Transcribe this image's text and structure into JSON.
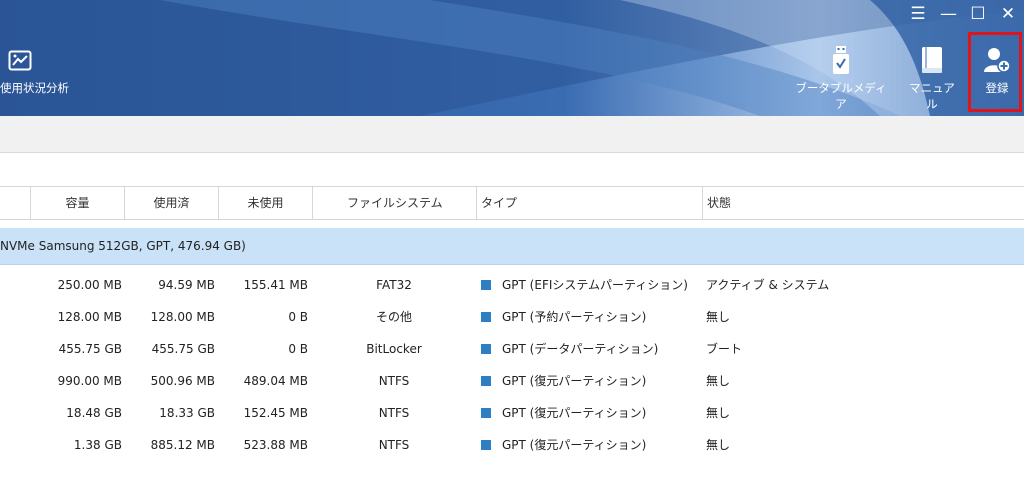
{
  "window_controls": {
    "menu": "☰",
    "minimize": "—",
    "maximize": "☐",
    "close": "✕"
  },
  "toolbar": {
    "usage_label": "使用状況分析",
    "media_label": "ブータブルメディア",
    "manual_label": "マニュアル",
    "register_label": "登録"
  },
  "colors": {
    "header": "#2f5d9f",
    "highlight": "#e0141b",
    "selected_row": "#c9e2f7",
    "type_marker": "#2e7fc1"
  },
  "table": {
    "headers": {
      "capacity": "容量",
      "used": "使用済",
      "unused": "未使用",
      "filesystem": "ファイルシステム",
      "type": "タイプ",
      "status": "状態"
    },
    "disk_label": "NVMe Samsung 512GB, GPT, 476.94 GB)",
    "rows": [
      {
        "capacity": "250.00 MB",
        "used": "94.59 MB",
        "unused": "155.41 MB",
        "fs": "FAT32",
        "type": "GPT (EFIシステムパーティション)",
        "status": "アクティブ & システム"
      },
      {
        "capacity": "128.00 MB",
        "used": "128.00 MB",
        "unused": "0 B",
        "fs": "その他",
        "type": "GPT (予約パーティション)",
        "status": "無し"
      },
      {
        "capacity": "455.75 GB",
        "used": "455.75 GB",
        "unused": "0 B",
        "fs": "BitLocker",
        "type": "GPT (データパーティション)",
        "status": "ブート"
      },
      {
        "capacity": "990.00 MB",
        "used": "500.96 MB",
        "unused": "489.04 MB",
        "fs": "NTFS",
        "type": "GPT (復元パーティション)",
        "status": "無し"
      },
      {
        "capacity": "18.48 GB",
        "used": "18.33 GB",
        "unused": "152.45 MB",
        "fs": "NTFS",
        "type": "GPT (復元パーティション)",
        "status": "無し"
      },
      {
        "capacity": "1.38 GB",
        "used": "885.12 MB",
        "unused": "523.88 MB",
        "fs": "NTFS",
        "type": "GPT (復元パーティション)",
        "status": "無し"
      }
    ]
  }
}
